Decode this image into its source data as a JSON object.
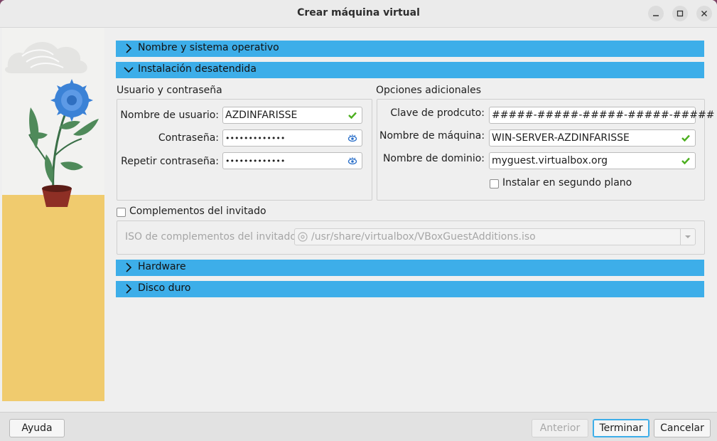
{
  "window": {
    "title": "Crear máquina virtual"
  },
  "sections": {
    "name_os": "Nombre y sistema operativo",
    "unattended": "Instalación desatendida",
    "hardware": "Hardware",
    "disk": "Disco duro"
  },
  "user_group": {
    "title": "Usuario y contraseña",
    "username_label": "Nombre de usuario:",
    "username_value": "AZDINFARISSE",
    "password_label": "Contraseña:",
    "password_value": "•••••••••••••",
    "repeat_label": "Repetir contraseña:",
    "repeat_value": "•••••••••••••"
  },
  "options_group": {
    "title": "Opciones adicionales",
    "key_label": "Clave de prodcuto:",
    "key_value": "#####-#####-#####-#####-#####",
    "hostname_label": "Nombre de máquina:",
    "hostname_value": "WIN-SERVER-AZDINFARISSE",
    "domain_label": "Nombre de dominio:",
    "domain_value": "myguest.virtualbox.org",
    "background_label": "Instalar en segundo plano",
    "background_checked": false
  },
  "guest_additions": {
    "label": "Complementos del invitado",
    "checked": false,
    "iso_label": "ISO de complementos del invitado:",
    "iso_value": "/usr/share/virtualbox/VBoxGuestAdditions.iso"
  },
  "footer": {
    "help": "Ayuda",
    "back": "Anterior",
    "finish": "Terminar",
    "cancel": "Cancelar"
  },
  "colors": {
    "section_header": "#3daee9",
    "valid_check": "#4caf1f",
    "eye_icon": "#2a6fc9"
  },
  "icons": {
    "valid": "check-icon",
    "reveal": "eye-icon",
    "expand": "chevron-right-icon",
    "collapse": "chevron-down-icon"
  }
}
